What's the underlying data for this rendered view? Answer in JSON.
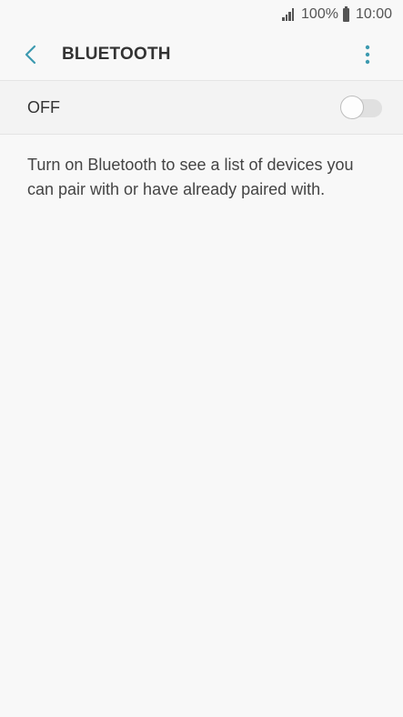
{
  "status_bar": {
    "battery_percent": "100%",
    "time": "10:00",
    "signal_icon": "signal-icon",
    "battery_icon": "battery-icon"
  },
  "app_bar": {
    "title": "BLUETOOTH",
    "back_icon": "chevron-left-icon",
    "more_icon": "more-vertical-icon",
    "accent_color": "#3d9ab0"
  },
  "bluetooth_toggle": {
    "label": "OFF",
    "enabled": false
  },
  "info": {
    "text": "Turn on Bluetooth to see a list of devices you can pair with or have already paired with."
  }
}
